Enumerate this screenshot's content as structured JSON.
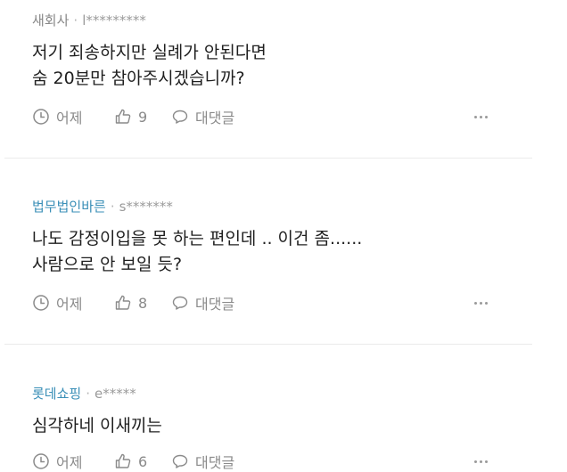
{
  "comments": [
    {
      "company": "새회사",
      "separator": "·",
      "user": "l*********",
      "text": "저기 죄송하지만 실례가 안된다면\n숨 20분만 참아주시겠습니까?",
      "time": "어제",
      "likes": "9",
      "reply_label": "대댓글"
    },
    {
      "company": "법무법인바른",
      "separator": "·",
      "user": "s*******",
      "text": "나도 감정이입을 못 하는 편인데 .. 이건 좀......\n사람으로 안 보일 듯?",
      "time": "어제",
      "likes": "8",
      "reply_label": "대댓글"
    },
    {
      "company": "롯데쇼핑",
      "separator": "·",
      "user": "e*****",
      "text": "심각하네 이새끼는",
      "time": "어제",
      "likes": "6",
      "reply_label": "대댓글"
    }
  ],
  "icons": {
    "time": "clock-icon",
    "like": "thumbs-up-icon",
    "reply": "speech-bubble-icon",
    "more": "more-horizontal-icon"
  },
  "colors": {
    "company_default": "#888888",
    "company_link": "#3a8fb7",
    "text": "#1f1f1f",
    "meta": "#8a8a8a"
  }
}
